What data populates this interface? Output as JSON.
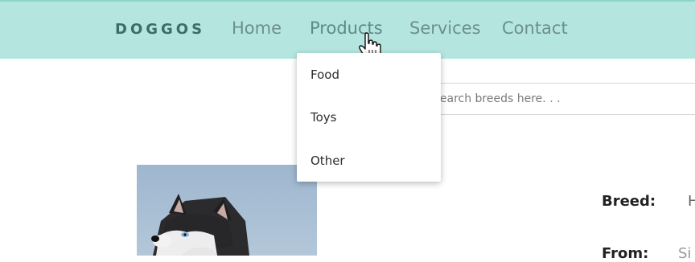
{
  "nav": {
    "brand": "DOGGOS",
    "links": [
      "Home",
      "Products",
      "Services",
      "Contact"
    ]
  },
  "dropdown": {
    "items": [
      "Food",
      "Toys",
      "Other"
    ]
  },
  "search": {
    "placeholder": "Search breeds here. . ."
  },
  "details": {
    "breed_label": "Breed:",
    "breed_value": "H",
    "from_label": "From:",
    "from_value": "Si"
  },
  "colors": {
    "navbar_bg": "#b4e6df",
    "brand_text": "#3f6b68",
    "nav_link_text": "#6d8f8c"
  }
}
